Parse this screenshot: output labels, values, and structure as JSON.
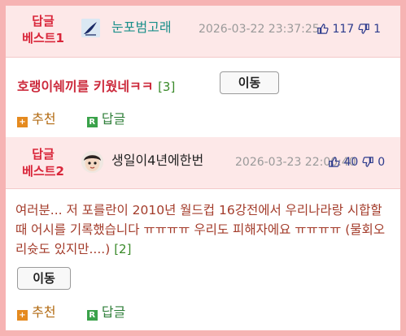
{
  "posts": [
    {
      "badge_line1": "답글",
      "badge_line2": "베스트1",
      "username": "눈포범고래",
      "username_color": "#1a8f8a",
      "date": "2026-03-22 23:37:25",
      "likes": "117",
      "dislikes": "1",
      "title": "호랭이쉐끼를 키웠네ㅋㅋ",
      "reply_count": "[3]",
      "move_button": "이동",
      "recommend_label": "추천",
      "reply_label": "답글"
    },
    {
      "badge_line1": "답글",
      "badge_line2": "베스트2",
      "username": "생일이4년에한번",
      "username_color": "#222222",
      "date": "2026-03-23 22:00:40",
      "likes": "40",
      "dislikes": "0",
      "body": "여러분... 저 포를란이 2010년 월드컵 16강전에서 우리나라랑 시합할때 어시를 기록했습니다 ㅠㅠㅠㅠ 우리도 피해자에요 ㅠㅠㅠㅠ (물회오리슛도 있지만....)",
      "reply_count": "[2]",
      "move_button": "이동",
      "recommend_label": "추천",
      "reply_label": "답글"
    }
  ],
  "icons": {
    "thumbs_up": "thumbs-up-icon",
    "thumbs_down": "thumbs-down-icon",
    "recommend": "plus-icon",
    "reply": "reply-r-icon"
  },
  "colors": {
    "border": "#f6b3b3",
    "header_bg": "#fde8e8",
    "accent_red": "#d9263a"
  }
}
